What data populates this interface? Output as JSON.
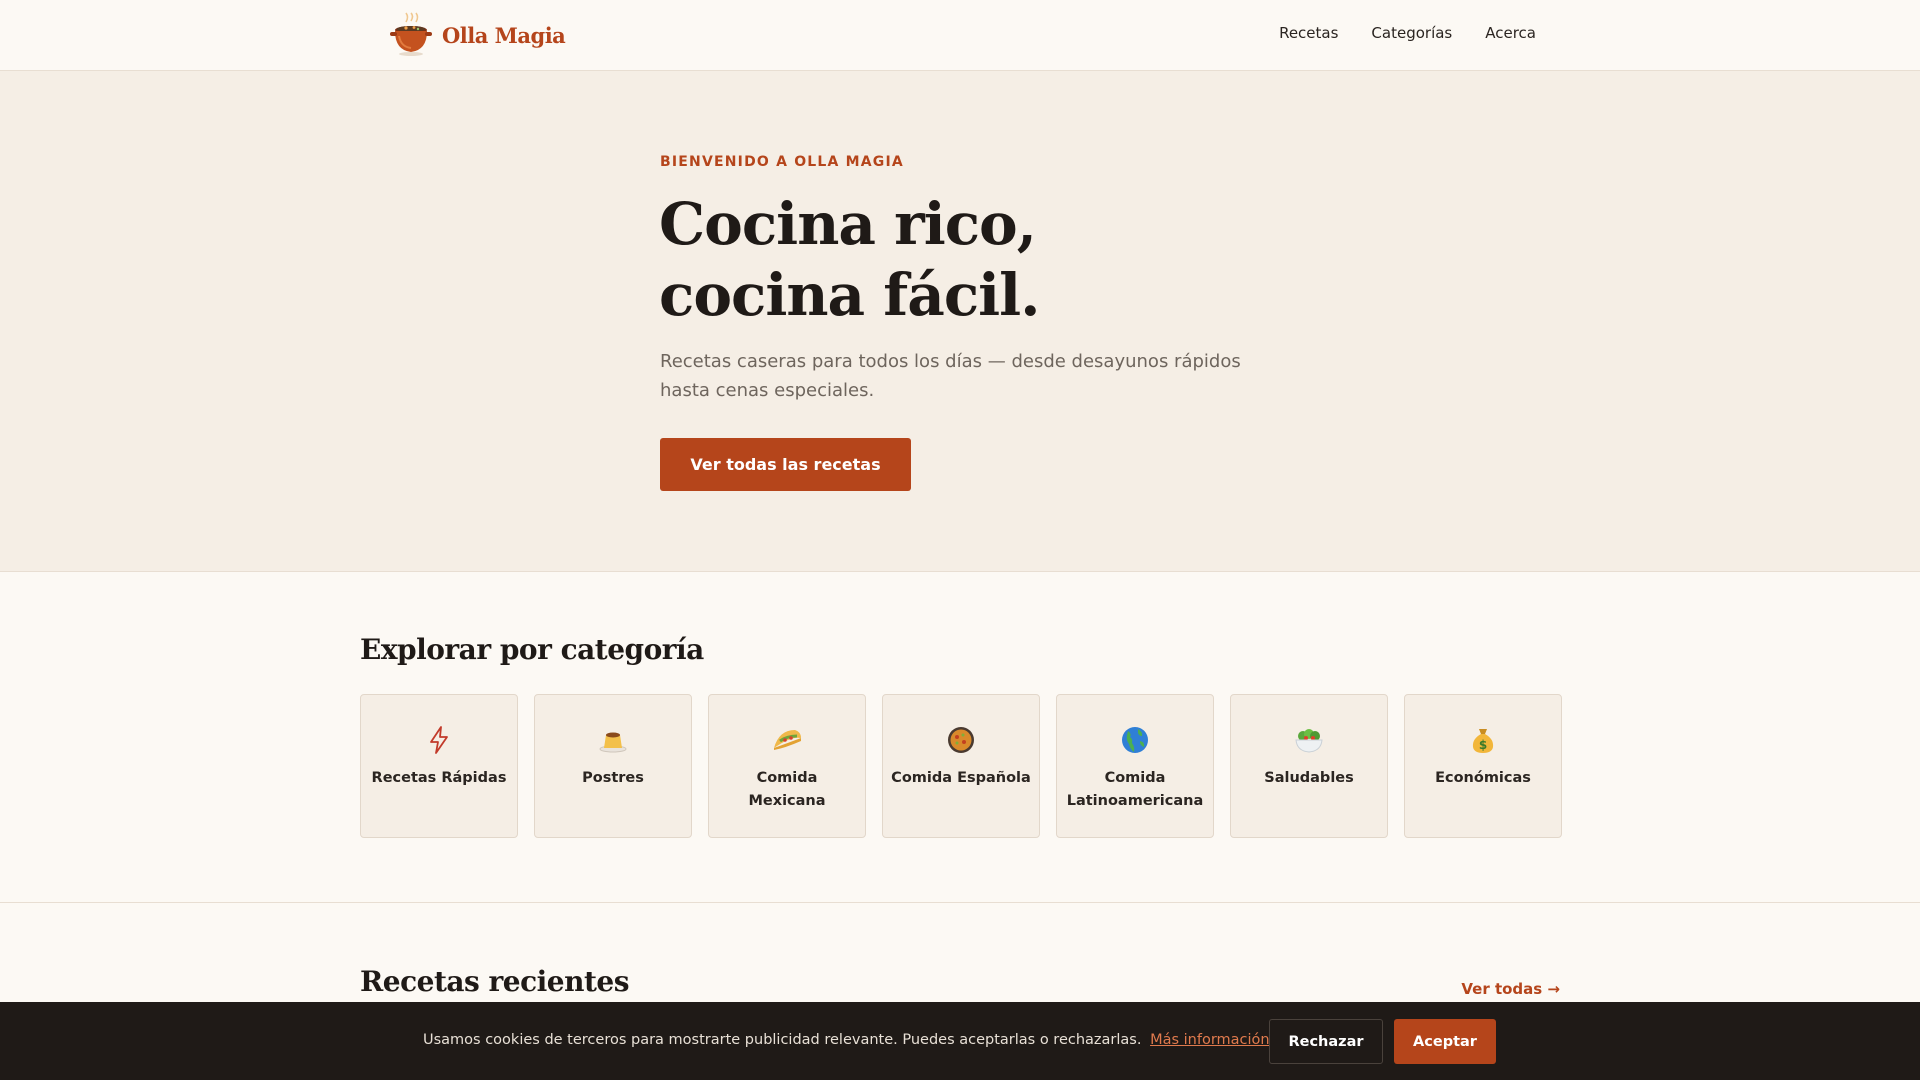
{
  "brand": {
    "name": "Olla Magia",
    "color": "#b5451b"
  },
  "nav": {
    "items": [
      {
        "label": "Recetas"
      },
      {
        "label": "Categorías"
      },
      {
        "label": "Acerca"
      }
    ]
  },
  "hero": {
    "eyebrow": "BIENVENIDO A OLLA MAGIA",
    "title_line1": "Cocina rico,",
    "title_line2": "cocina fácil.",
    "subtitle": "Recetas caseras para todos los días — desde desayunos rápidos hasta cenas especiales.",
    "cta_label": "Ver todas las recetas"
  },
  "categories": {
    "title": "Explorar por categoría",
    "items": [
      {
        "icon": "lightning-icon",
        "glyph": "⚡",
        "label": "Recetas Rápidas"
      },
      {
        "icon": "flan-icon",
        "glyph": "🍮",
        "label": "Postres"
      },
      {
        "icon": "taco-icon",
        "glyph": "🌮",
        "label": "Comida Mexicana"
      },
      {
        "icon": "paella-icon",
        "glyph": "🥘",
        "label": "Comida Española"
      },
      {
        "icon": "globe-icon",
        "glyph": "🌎",
        "label": "Comida Latinoamericana"
      },
      {
        "icon": "salad-icon",
        "glyph": "🥗",
        "label": "Saludables"
      },
      {
        "icon": "money-bag-icon",
        "glyph": "💰",
        "label": "Económicas"
      }
    ]
  },
  "recent": {
    "title": "Recetas recientes",
    "see_all_label": "Ver todas →"
  },
  "cookie_banner": {
    "text": "Usamos cookies de terceros para mostrarte publicidad relevante. Puedes aceptarlas o rechazarlas.",
    "link_label": "Más información",
    "reject_label": "Rechazar",
    "accept_label": "Aceptar"
  }
}
